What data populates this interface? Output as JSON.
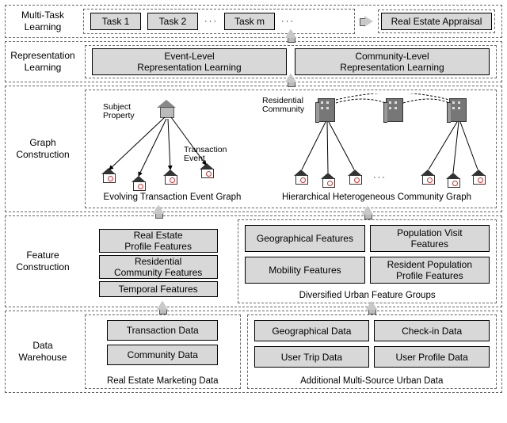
{
  "layers": {
    "multitask": {
      "label": "Multi-Task\nLearning",
      "tasks": [
        "Task 1",
        "Task 2",
        "Task m"
      ],
      "ellipsis": "···",
      "final": "Real Estate Appraisal"
    },
    "repr": {
      "label": "Representation\nLearning",
      "left": "Event-Level\nRepresentation Learning",
      "right": "Community-Level\nRepresentation Learning"
    },
    "graph": {
      "label": "Graph\nConstruction",
      "subject_label": "Subject\nProperty",
      "trans_label": "Transaction\nEvent",
      "res_label": "Residential\nCommunity",
      "left_caption": "Evolving Transaction Event Graph",
      "right_caption": "Hierarchical Heterogeneous Community Graph",
      "ellipsis": "···"
    },
    "feature": {
      "label": "Feature\nConstruction",
      "left": {
        "items": [
          "Real Estate\nProfile Features",
          "Residential\nCommunity Features",
          "Temporal Features"
        ]
      },
      "right": {
        "items": [
          "Geographical Features",
          "Population Visit\nFeatures",
          "Mobility Features",
          "Resident Population\nProfile Features"
        ],
        "caption": "Diversified Urban Feature Groups"
      }
    },
    "data": {
      "label": "Data\nWarehouse",
      "left": {
        "items": [
          "Transaction Data",
          "Community Data"
        ],
        "caption": "Real Estate Marketing Data"
      },
      "right": {
        "items": [
          "Geographical Data",
          "Check-in Data",
          "User Trip Data",
          "User Profile Data"
        ],
        "caption": "Additional Multi-Source Urban Data"
      }
    }
  }
}
